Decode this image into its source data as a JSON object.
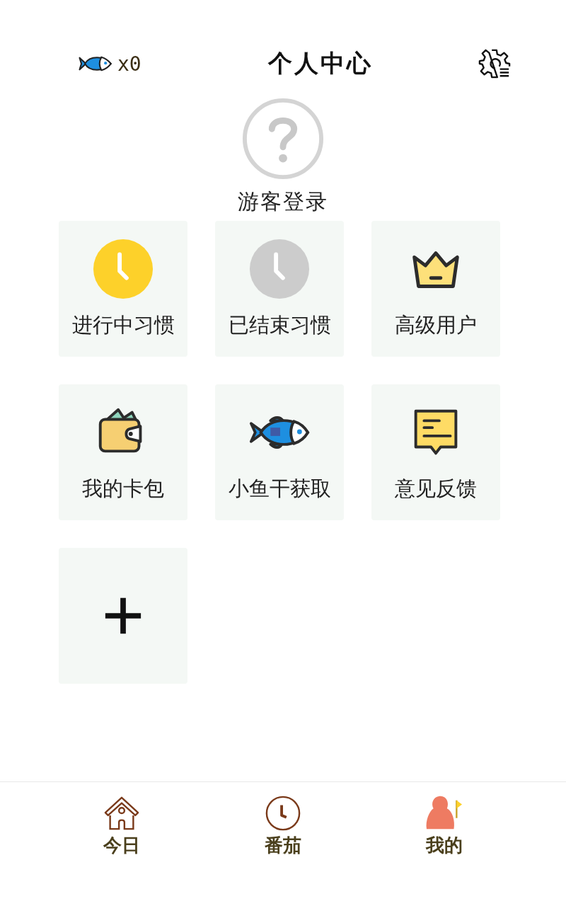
{
  "header": {
    "fish_count": "x0",
    "title": "个人中心"
  },
  "profile": {
    "name": "游客登录"
  },
  "tiles": [
    {
      "kind": "clock-active",
      "label": "进行中习惯"
    },
    {
      "kind": "clock-ended",
      "label": "已结束习惯"
    },
    {
      "kind": "crown",
      "label": "高级用户"
    },
    {
      "kind": "wallet",
      "label": "我的卡包"
    },
    {
      "kind": "fish",
      "label": "小鱼干获取"
    },
    {
      "kind": "feedback",
      "label": "意见反馈"
    },
    {
      "kind": "add"
    }
  ],
  "tab_bar": [
    {
      "kind": "house",
      "label": "今日"
    },
    {
      "kind": "clock",
      "label": "番茄"
    },
    {
      "kind": "person",
      "label": "我的"
    }
  ]
}
